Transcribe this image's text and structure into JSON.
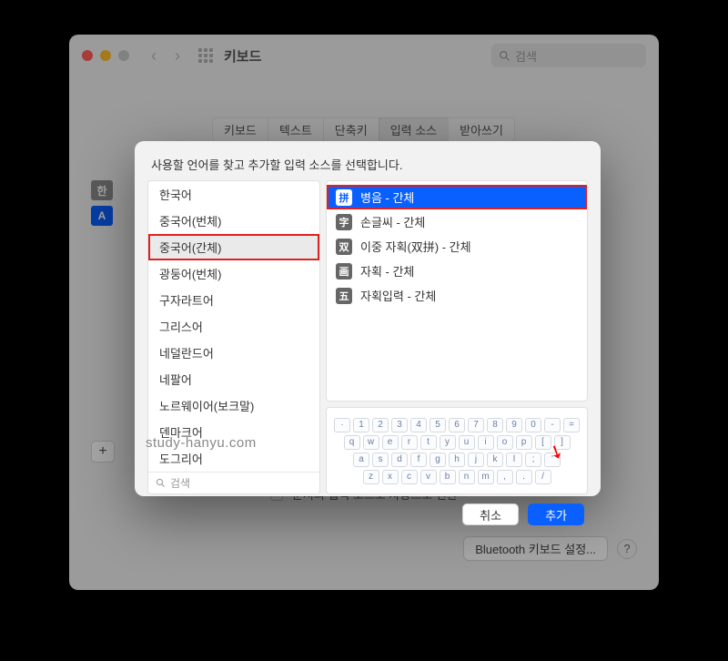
{
  "window": {
    "title": "키보드",
    "search_placeholder": "검색",
    "tabs": [
      "키보드",
      "텍스트",
      "단축키",
      "입력 소스",
      "받아쓰기"
    ],
    "active_tab_index": 3,
    "footer_text": "문서의 입력 소스로 자동으로 전환",
    "bluetooth_button": "Bluetooth 키보드 설정...",
    "side_badges": [
      "한",
      "A"
    ],
    "plus_label": "+"
  },
  "sheet": {
    "title": "사용할 언어를 찾고 추가할 입력 소스를 선택합니다.",
    "languages": [
      "한국어",
      "중국어(번체)",
      "중국어(간체)",
      "광둥어(번체)",
      "구자라트어",
      "그리스어",
      "네덜란드어",
      "네팔어",
      "노르웨이어(보크말)",
      "덴마크어",
      "도그리어"
    ],
    "selected_language_index": 2,
    "lang_search_placeholder": "검색",
    "sources": [
      {
        "badge": "拼",
        "label": "병음 - 간체"
      },
      {
        "badge": "字",
        "label": "손글씨 - 간체"
      },
      {
        "badge": "双",
        "label": "이중 자획(双拼) - 간체"
      },
      {
        "badge": "画",
        "label": "자획 - 간체"
      },
      {
        "badge": "五",
        "label": "자획입력 - 간체"
      }
    ],
    "selected_source_index": 0,
    "keyboard_rows": [
      [
        "·",
        "1",
        "2",
        "3",
        "4",
        "5",
        "6",
        "7",
        "8",
        "9",
        "0",
        "-",
        "="
      ],
      [
        "q",
        "w",
        "e",
        "r",
        "t",
        "y",
        "u",
        "i",
        "o",
        "p",
        "[",
        "]"
      ],
      [
        "a",
        "s",
        "d",
        "f",
        "g",
        "h",
        "j",
        "k",
        "l",
        ";",
        "'"
      ],
      [
        "z",
        "x",
        "c",
        "v",
        "b",
        "n",
        "m",
        ",",
        ".",
        "/"
      ]
    ],
    "cancel": "취소",
    "add": "추가"
  },
  "watermark": "study-hanyu.com"
}
